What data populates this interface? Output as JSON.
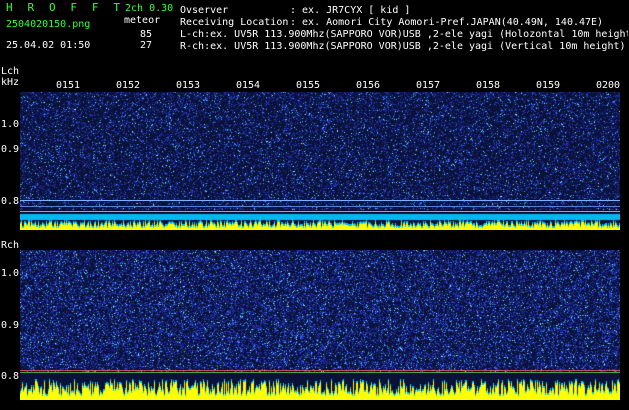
{
  "header": {
    "logo_letters": [
      "H",
      "R",
      "O",
      "F",
      "F",
      "T"
    ],
    "version": "2ch 0.30",
    "filename": "2504020150.png",
    "timestamp": "25.04.02 01:50",
    "meteor_label": "meteor",
    "meteor_lch": "85",
    "meteor_rch": "27",
    "observer_label": "Ovserver",
    "observer_value": ": ex. JR7CYX [ kid ]",
    "location_label": "Receiving Location",
    "location_value": ": ex. Aomori City Aomori-Pref.JAPAN(40.49N, 140.47E)",
    "lch_info": "L-ch:ex. UV5R 113.900Mhz(SAPPORO VOR)USB ,2-ele yagi (Holozontal 10m height)",
    "rch_info": "R-ch:ex. UV5R 113.900Mhz(SAPPORO VOR)USB ,2-ele yagi (Vertical 10m height)"
  },
  "time_labels": [
    "0151",
    "0152",
    "0153",
    "0154",
    "0155",
    "0156",
    "0157",
    "0158",
    "0159",
    "0200"
  ],
  "lch": {
    "label": "Lch",
    "unit": "kHz",
    "freq_labels": [
      "1.0",
      "0.9",
      "0.8"
    ]
  },
  "rch": {
    "label": "Rch",
    "freq_labels": [
      "1.0",
      "0.9",
      "0.8"
    ]
  },
  "colors": {
    "background": "#000000",
    "text_green": "#33ff33",
    "text_white": "#ffffff",
    "noise_blue": "#2030a0",
    "noise_cyan": "#20c0ff",
    "signal_yellow": "#ffff00",
    "band_cyan": "#00e0ff"
  }
}
